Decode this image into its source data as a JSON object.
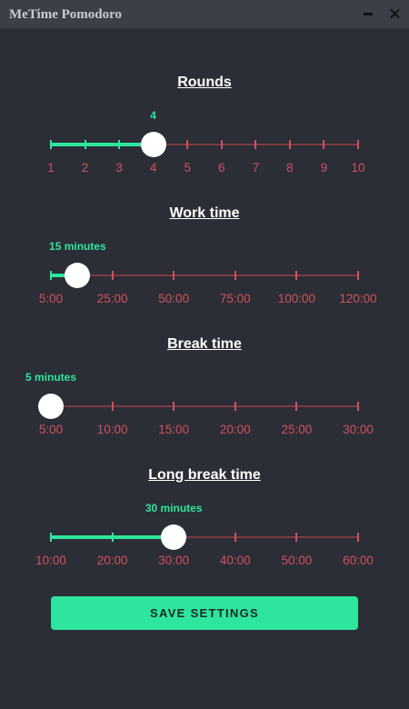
{
  "window": {
    "title": "MeTime Pomodoro"
  },
  "colors": {
    "accent": "#2ee59d",
    "track": "#7b3b45",
    "tick_label": "#d2505d",
    "background": "#2b2e36"
  },
  "sliders": [
    {
      "title": "Rounds",
      "value_label": "4",
      "value_fraction": 0.3333,
      "ticks": [
        "1",
        "2",
        "3",
        "4",
        "5",
        "6",
        "7",
        "8",
        "9",
        "10"
      ]
    },
    {
      "title": "Work time",
      "value_label": "15 minutes",
      "value_fraction": 0.087,
      "ticks": [
        "5:00",
        "25:00",
        "50:00",
        "75:00",
        "100:00",
        "120:00"
      ]
    },
    {
      "title": "Break time",
      "value_label": "5 minutes",
      "value_fraction": 0,
      "ticks": [
        "5:00",
        "10:00",
        "15:00",
        "20:00",
        "25:00",
        "30:00"
      ]
    },
    {
      "title": "Long break time",
      "value_label": "30 minutes",
      "value_fraction": 0.4,
      "ticks": [
        "10:00",
        "20:00",
        "30:00",
        "40:00",
        "50:00",
        "60:00"
      ]
    }
  ],
  "actions": {
    "save_label": "SAVE SETTINGS"
  }
}
